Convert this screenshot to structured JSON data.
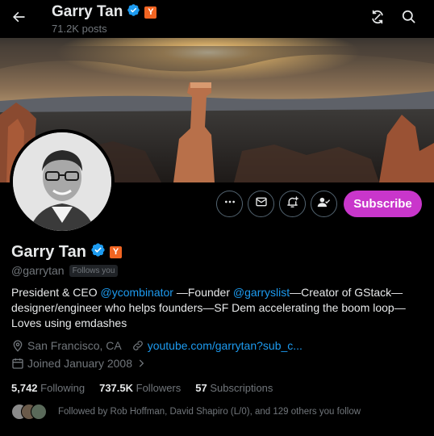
{
  "topbar": {
    "name": "Garry Tan",
    "posts": "71.2K posts",
    "yc_badge": "Y",
    "icons": [
      "back-arrow-icon",
      "repost-icon",
      "search-icon"
    ]
  },
  "profile": {
    "name": "Garry Tan",
    "yc_badge": "Y",
    "handle": "@garrytan",
    "follows_you": "Follows you",
    "bio": {
      "p1": "President & CEO ",
      "link1": "@ycombinator",
      "p2": " —Founder ",
      "link2": "@garryslist",
      "p3": "—Creator of GStack—designer/engineer who helps founders—SF Dem accelerating the boom loop—Loves using emdashes"
    },
    "location": "San Francisco, CA",
    "website": "youtube.com/garrytan?sub_c...",
    "joined": "Joined January 2008"
  },
  "actions": {
    "subscribe": "Subscribe",
    "icons": [
      "more-icon",
      "message-icon",
      "notification-icon",
      "following-icon"
    ]
  },
  "stats": {
    "following_count": "5,742",
    "following_label": "Following",
    "followers_count": "737.5K",
    "followers_label": "Followers",
    "subscriptions_count": "57",
    "subscriptions_label": "Subscriptions"
  },
  "followed_by": "Followed by Rob Hoffman, David Shapiro (L/0), and 129 others you follow",
  "colors": {
    "accent": "#1d9bf0",
    "subscribe": "#c936cb",
    "yc": "#f26522",
    "muted": "#71767b"
  }
}
